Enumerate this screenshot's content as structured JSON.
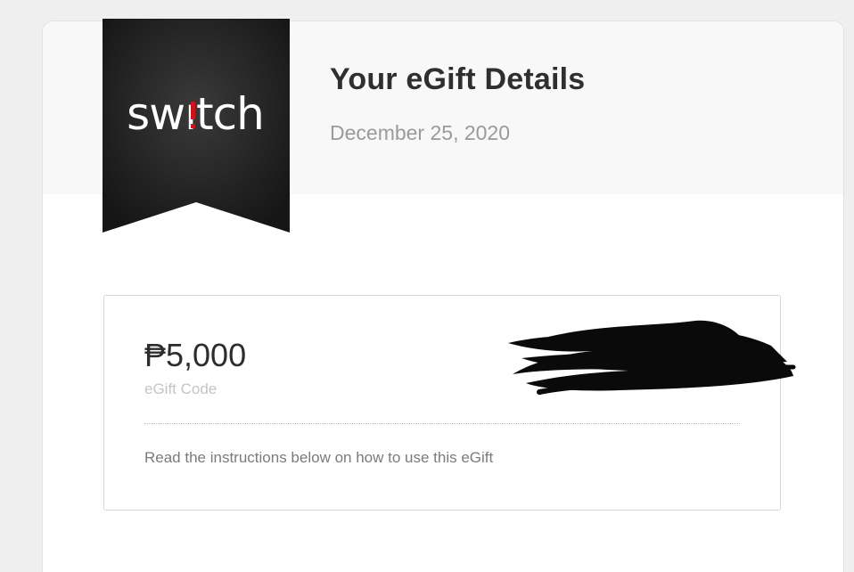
{
  "brand": {
    "logo_text": "switch",
    "accent_color": "#d0121b",
    "ribbon_color": "#1f1f1f"
  },
  "header": {
    "title": "Your eGift Details",
    "date": "December 25, 2020"
  },
  "gift": {
    "amount": "₱5,000",
    "code_label": "eGift Code",
    "code_value_state": "redacted",
    "instructions": "Read the instructions below on how to use this eGift"
  }
}
